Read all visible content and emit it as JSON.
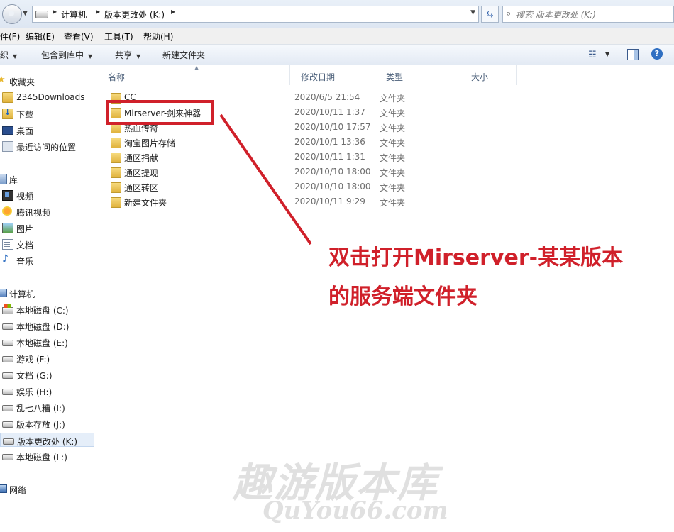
{
  "address": {
    "crumbs": [
      "计算机",
      "版本更改处 (K:)"
    ],
    "search_placeholder": "搜索 版本更改处 (K:)"
  },
  "menu": [
    "件(F)",
    "编辑(E)",
    "查看(V)",
    "工具(T)",
    "帮助(H)"
  ],
  "toolbar": {
    "organize": "织",
    "include_library": "包含到库中",
    "share": "共享",
    "new_folder": "新建文件夹"
  },
  "nav": {
    "favorites": "收藏夹",
    "fav_items": [
      "2345Downloads",
      "下载",
      "桌面",
      "最近访问的位置"
    ],
    "libraries": "库",
    "lib_items": [
      "视频",
      "腾讯视频",
      "图片",
      "文档",
      "音乐"
    ],
    "computer": "计算机",
    "drives": [
      "本地磁盘 (C:)",
      "本地磁盘 (D:)",
      "本地磁盘 (E:)",
      "游戏 (F:)",
      "文档 (G:)",
      "娱乐 (H:)",
      "乱七八糟 (I:)",
      "版本存放 (J:)",
      "版本更改处 (K:)",
      "本地磁盘 (L:)"
    ],
    "network": "网络"
  },
  "columns": {
    "name": "名称",
    "date": "修改日期",
    "type": "类型",
    "size": "大小"
  },
  "files": [
    {
      "name": "CC",
      "date": "2020/6/5 21:54",
      "type": "文件夹"
    },
    {
      "name": "Mirserver-剑来神器",
      "date": "2020/10/11 1:37",
      "type": "文件夹"
    },
    {
      "name": "热血传奇",
      "date": "2020/10/10 17:57",
      "type": "文件夹"
    },
    {
      "name": "淘宝图片存储",
      "date": "2020/10/1 13:36",
      "type": "文件夹"
    },
    {
      "name": "通区捐献",
      "date": "2020/10/11 1:31",
      "type": "文件夹"
    },
    {
      "name": "通区提现",
      "date": "2020/10/10 18:00",
      "type": "文件夹"
    },
    {
      "name": "通区转区",
      "date": "2020/10/10 18:00",
      "type": "文件夹"
    },
    {
      "name": "新建文件夹",
      "date": "2020/10/11 9:29",
      "type": "文件夹"
    }
  ],
  "annotation": {
    "line1": "双击打开Mirserver-某某版本",
    "line2": "的服务端文件夹",
    "color": "#d0202a"
  },
  "watermark": {
    "cn": "趣游版本库",
    "en": "QuYou66.com"
  }
}
